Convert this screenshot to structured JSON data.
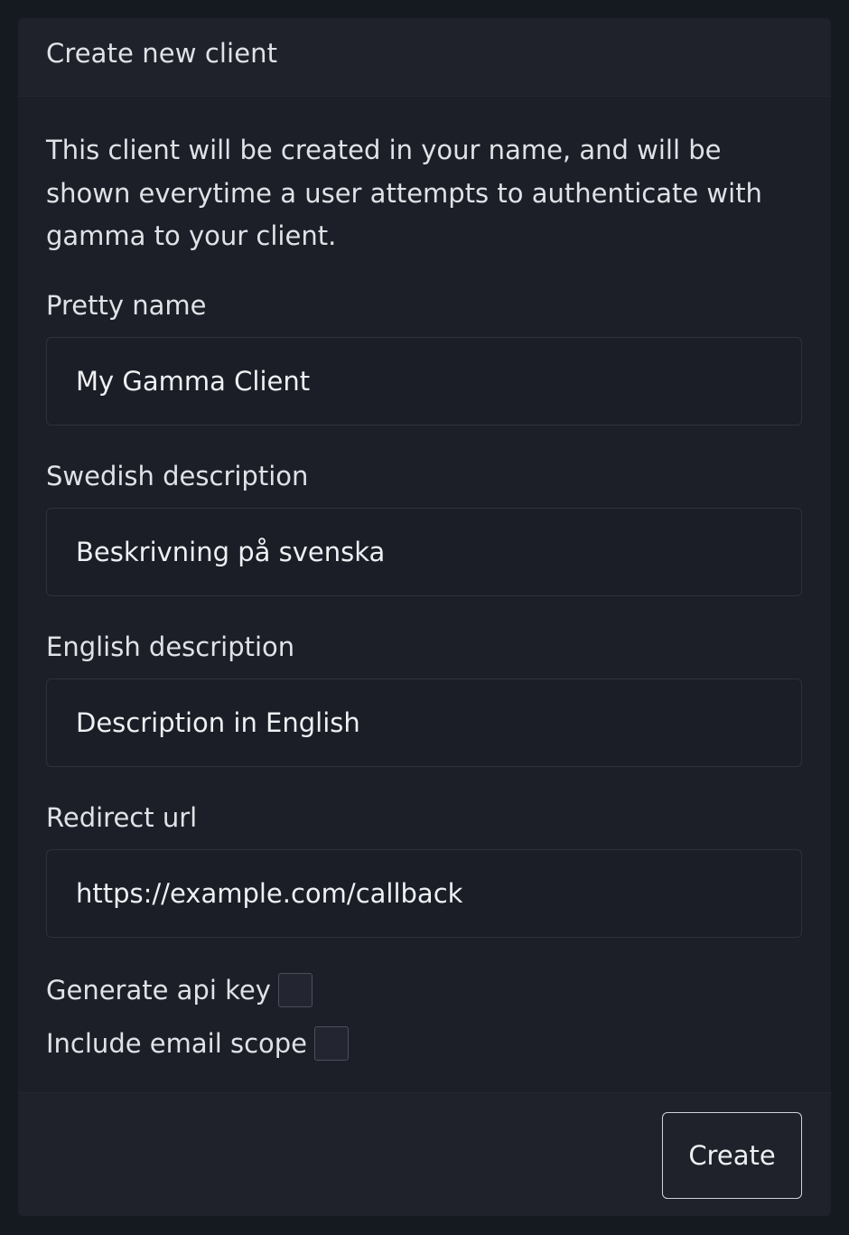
{
  "card": {
    "title": "Create new client",
    "intro": "This client will be created in your name, and will be shown everytime a user attempts to authenticate with gamma to your client."
  },
  "form": {
    "pretty_name": {
      "label": "Pretty name",
      "value": "My Gamma Client"
    },
    "swedish_description": {
      "label": "Swedish description",
      "value": "Beskrivning på svenska"
    },
    "english_description": {
      "label": "English description",
      "value": "Description in English"
    },
    "redirect_url": {
      "label": "Redirect url",
      "value": "https://example.com/callback"
    },
    "generate_api_key": {
      "label": "Generate api key",
      "checked": false
    },
    "include_email_scope": {
      "label": "Include email scope",
      "checked": false
    }
  },
  "footer": {
    "create_label": "Create"
  }
}
